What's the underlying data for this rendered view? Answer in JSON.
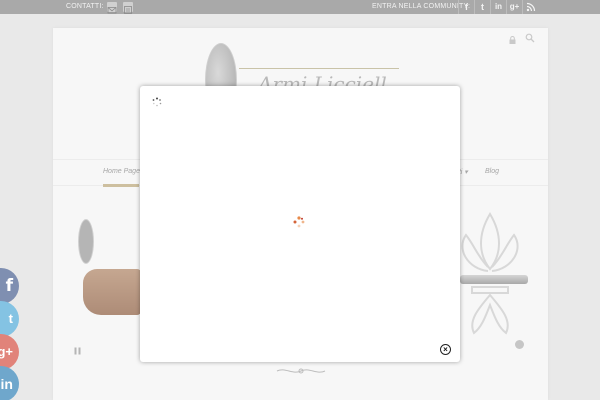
{
  "topbar": {
    "contacts_label": "CONTATTI:",
    "community_label": "ENTRA NELLA COMMUNITY:",
    "contact_icons": [
      "email-icon",
      "contact-card-icon"
    ],
    "social_icons": [
      "facebook-icon",
      "twitter-icon",
      "linkedin-icon",
      "google-plus-icon",
      "rss-icon"
    ],
    "social_glyphs": {
      "facebook": "f",
      "twitter": "t",
      "linkedin": "in",
      "googleplus": "g+",
      "rss": "⌇"
    }
  },
  "site": {
    "logo_text": "Armi Licciello"
  },
  "nav": {
    "home": "Home Page",
    "contatti": "atti ▾",
    "blog": "Blog"
  },
  "floating_social": {
    "facebook": "f",
    "twitter": "t",
    "googleplus": "g+",
    "linkedin": "in"
  },
  "modal": {
    "close_glyph": "×"
  },
  "colors": {
    "topbar": "#a9a9a9",
    "accent_gold": "#cdbf9f",
    "facebook": "#7f8fb1",
    "twitter": "#84c3e3",
    "googleplus": "#e1837a",
    "linkedin": "#6fa7cc"
  }
}
